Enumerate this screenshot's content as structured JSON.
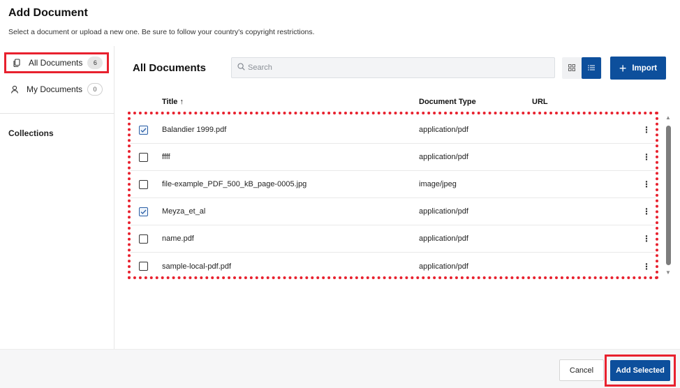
{
  "header": {
    "title": "Add Document",
    "subtitle": "Select a document or upload a new one. Be sure to follow your country's copyright restrictions."
  },
  "sidebar": {
    "items": [
      {
        "label": "All Documents",
        "count": "6",
        "icon": "documents-icon",
        "selected": true
      },
      {
        "label": "My Documents",
        "count": "0",
        "icon": "user-icon",
        "selected": false
      }
    ],
    "collections_label": "Collections"
  },
  "main": {
    "title": "All Documents",
    "search_placeholder": "Search",
    "import_label": "Import",
    "columns": {
      "title": "Title ↑",
      "type": "Document Type",
      "url": "URL"
    },
    "rows": [
      {
        "title": "Balandier 1999.pdf",
        "type": "application/pdf",
        "url": "",
        "checked": true
      },
      {
        "title": "ffff",
        "type": "application/pdf",
        "url": "",
        "checked": false
      },
      {
        "title": "file-example_PDF_500_kB_page-0005.jpg",
        "type": "image/jpeg",
        "url": "",
        "checked": false
      },
      {
        "title": "Meyza_et_al",
        "type": "application/pdf",
        "url": "",
        "checked": true
      },
      {
        "title": "name.pdf",
        "type": "application/pdf",
        "url": "",
        "checked": false
      },
      {
        "title": "sample-local-pdf.pdf",
        "type": "application/pdf",
        "url": "",
        "checked": false
      }
    ]
  },
  "footer": {
    "cancel_label": "Cancel",
    "add_selected_label": "Add Selected"
  },
  "colors": {
    "primary": "#0d4f9c",
    "highlight": "#e8212e"
  }
}
